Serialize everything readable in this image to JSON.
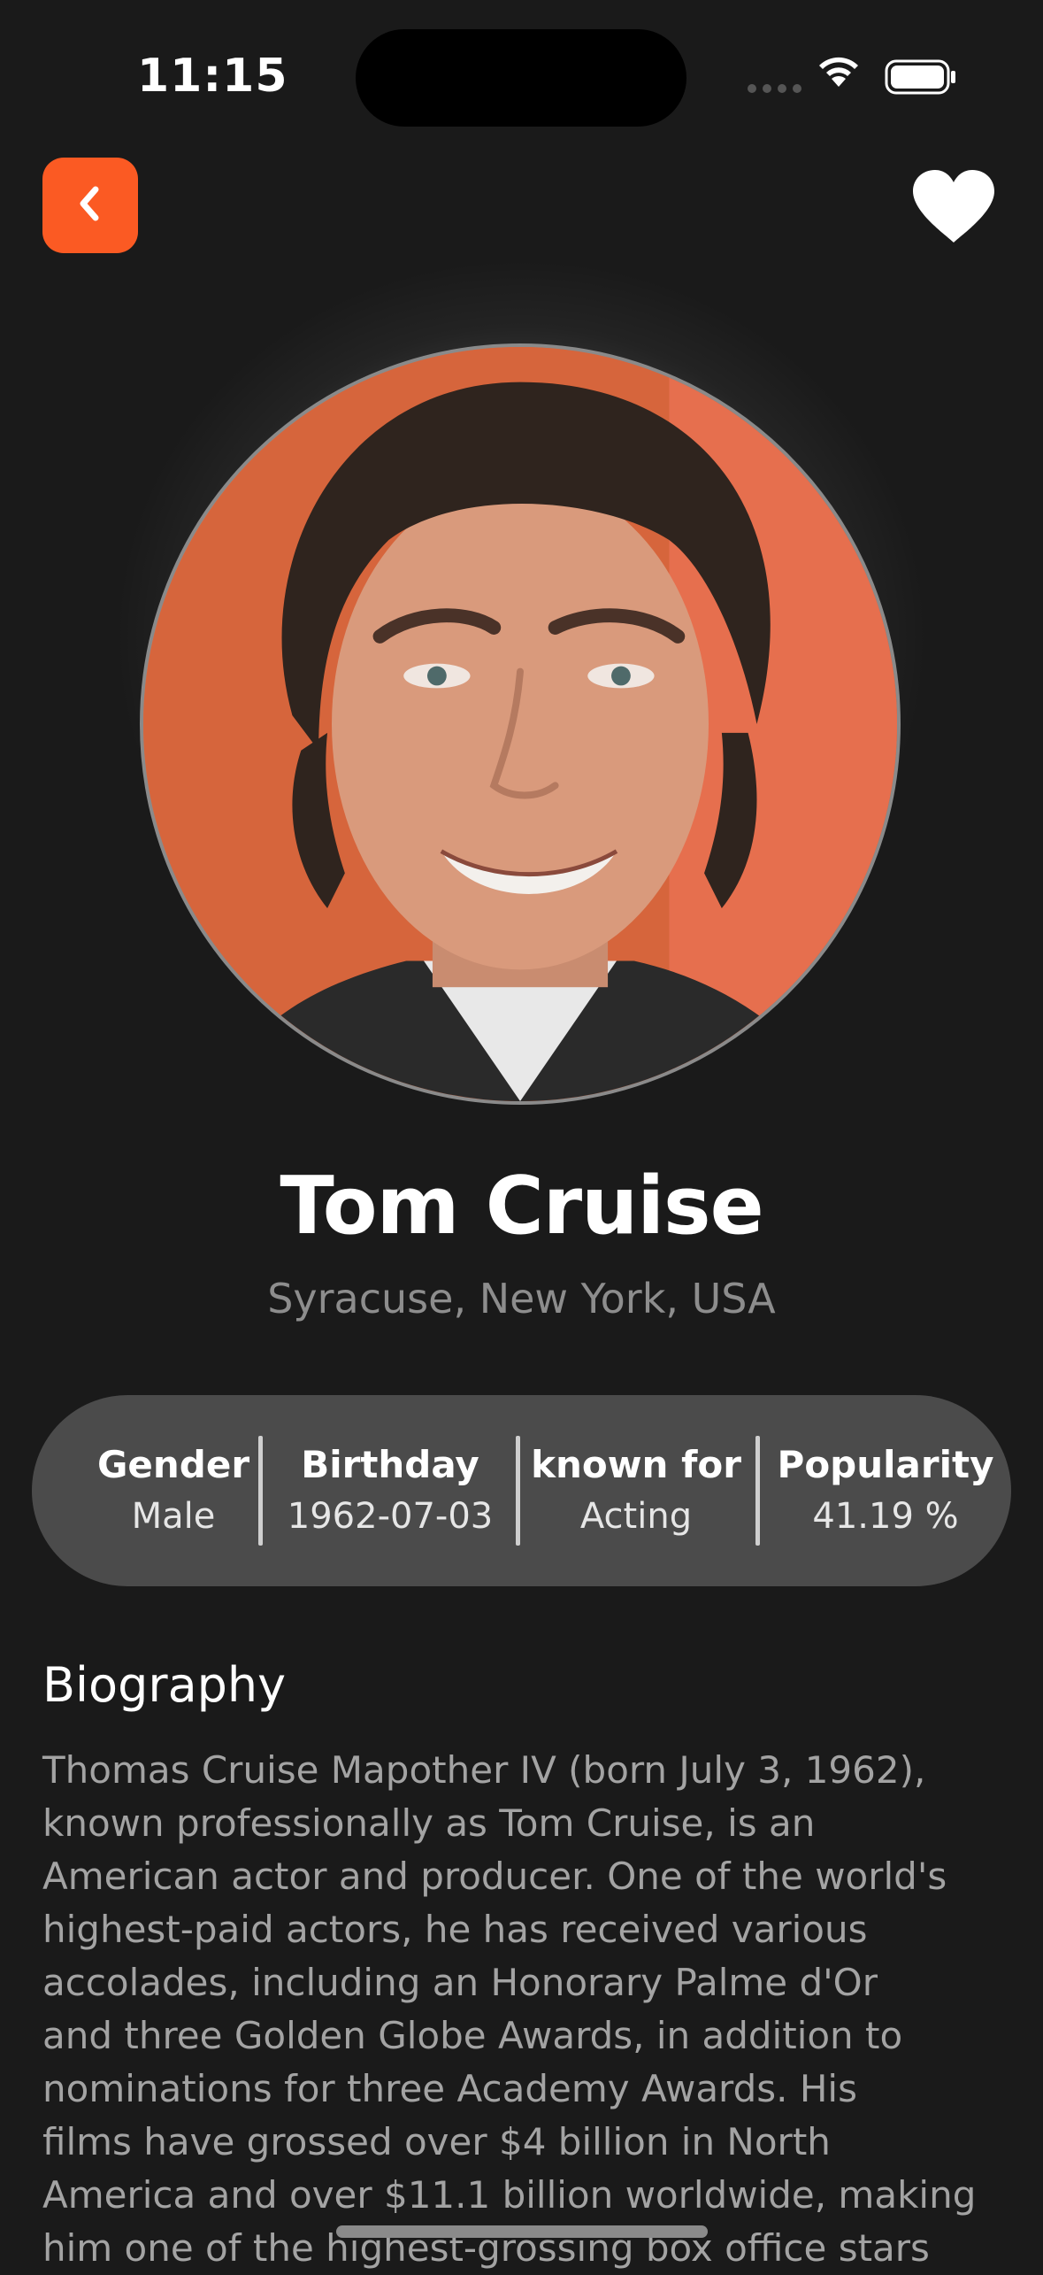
{
  "status_bar": {
    "time": "11:15",
    "icons": [
      "cellular-signal-icon",
      "wifi-icon",
      "battery-icon"
    ]
  },
  "header": {
    "back_icon": "chevron-left-icon",
    "favorite_icon": "heart-icon",
    "accent_color": "#fb5a23"
  },
  "profile": {
    "name": "Tom Cruise",
    "place_of_birth": "Syracuse, New York, USA",
    "photo": "portrait"
  },
  "info": {
    "items": [
      {
        "label": "Gender",
        "value": "Male"
      },
      {
        "label": "Birthday",
        "value": "1962-07-03"
      },
      {
        "label": "known for",
        "value": "Acting"
      },
      {
        "label": "Popularity",
        "value": "41.19 %"
      }
    ]
  },
  "biography": {
    "title": "Biography",
    "text": "Thomas Cruise Mapother IV (born July 3, 1962),\nknown professionally as Tom Cruise, is an\nAmerican actor and producer. One of the world's\nhighest-paid actors, he has received various\naccolades, including an Honorary Palme d'Or\nand three Golden Globe Awards, in addition to\nnominations for three Academy Awards. His\nfilms have grossed over $4 billion in North\nAmerica and over $11.1 billion worldwide, making\nhim one of the highest-grossing box office stars"
  }
}
